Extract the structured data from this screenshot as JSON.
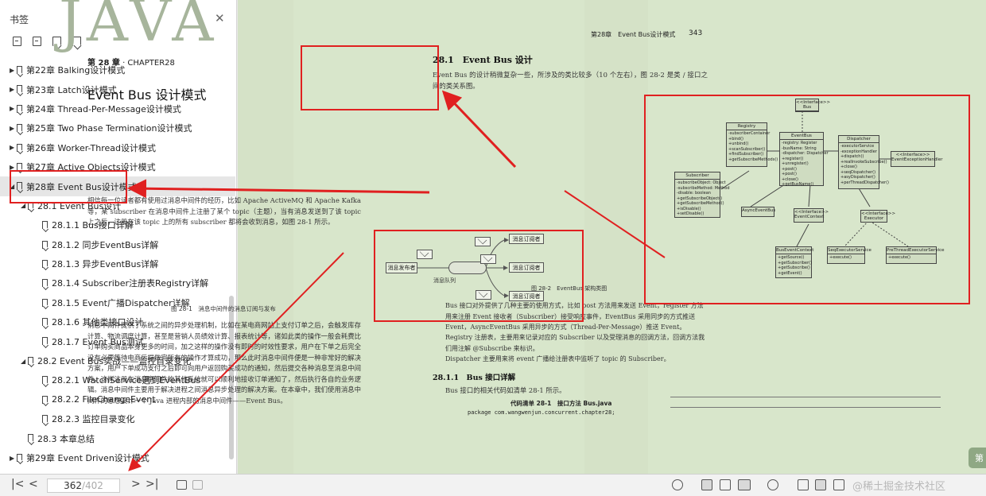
{
  "sidebar": {
    "title": "书签",
    "items": [
      {
        "label": "第22章 Balking设计模式",
        "level": 0,
        "expanded": false
      },
      {
        "label": "第23章 Latch设计模式",
        "level": 0,
        "expanded": false
      },
      {
        "label": "第24章 Thread-Per-Message设计模式",
        "level": 0,
        "expanded": false
      },
      {
        "label": "第25章 Two Phase Termination设计模式",
        "level": 0,
        "expanded": false
      },
      {
        "label": "第26章 Worker-Thread设计模式",
        "level": 0,
        "expanded": false
      },
      {
        "label": "第27章 Active Objects设计模式",
        "level": 0,
        "expanded": false
      },
      {
        "label": "第28章 Event Bus设计模式",
        "level": 0,
        "expanded": true,
        "selected": true
      },
      {
        "label": "28.1 Event Bus设计",
        "level": 1,
        "expanded": true
      },
      {
        "label": "28.1.1 Bus接口详解",
        "level": 2
      },
      {
        "label": "28.1.2 同步EventBus详解",
        "level": 2
      },
      {
        "label": "28.1.3 异步EventBus详解",
        "level": 2
      },
      {
        "label": "28.1.4 Subscriber注册表Registry详解",
        "level": 2
      },
      {
        "label": "28.1.5 Event广播Dispatcher详解",
        "level": 2
      },
      {
        "label": "28.1.6 其他类接口设计",
        "level": 2
      },
      {
        "label": "28.1.7 Event Bus测试",
        "level": 2
      },
      {
        "label": "28.2 Event Bus实战——监控目录变化",
        "level": 1,
        "expanded": true
      },
      {
        "label": "28.2.1 WatchService遇到EventBus",
        "level": 2
      },
      {
        "label": "28.2.2 FileChangeEvent",
        "level": 2
      },
      {
        "label": "28.2.3 监控目录变化",
        "level": 2
      },
      {
        "label": "28.3 本章总结",
        "level": 1
      },
      {
        "label": "第29章 Event Driven设计模式",
        "level": 0,
        "expanded": false
      }
    ]
  },
  "page_left": {
    "watermark": "JAVA",
    "chapter_label": "第 28 章",
    "chapter_label_en": " · CHAPTER28",
    "chapter_title": "Event Bus 设计模式",
    "para1": "相信每一位读者都有使用过消息中间件的经历，比如 Apache ActiveMQ 和 Apache Kafka 等，某 subscriber 在消息中间件上注册了某个 topic（主题），当有消息发送到了该 topic 上之后，注册在该 topic 上的所有 subscriber 都将会收到消息，如图 28-1 所示。",
    "fig1": {
      "publisher": "消息发布者",
      "queue": "消息队列",
      "subscriber": "消息订阅者",
      "caption": "图 28-1　消息中间件的消息订阅与发布"
    },
    "para2": "消息中间件提供了系统之间的异步处理机制，比如在某电商网站上支付订单之后，会触发库存计算、物流调度计算，甚至是营销人员绩效计算、报表统计等，诸如此类的操作一般会耗费比订单购买商品本身更多的时间，加之这样的操作没有即时的时效性要求，用户在下单之后完全没有必要等待电商后端做完所有的操作才算成功，那么此时消息中间件便是一种非常好的解决方案，用户下单成功支付之后即可向用户返回购买成功的通知，然后提交各种消息至消息中间件，这样注册在消息中间件的其他系统就可以顺利地接收订单通知了，然后执行各自的业务逻辑。消息中间件主要用于解决进程之间消息异步处理的解决方案。在本章中，我们使用消息中间件的思想设计一个 Java 进程内部的消息中间件——Event Bus。"
  },
  "page_right": {
    "running_head": "第28章　Event Bus设计模式",
    "page_number": "343",
    "section_title": "28.1　Event Bus 设计",
    "para3": "Event Bus 的设计稍微复杂一些，所涉及的类比较多（10 个左右），图 28-2 是类 / 接口之间的类关系图。",
    "uml": {
      "bus": {
        "name": "<<Interface>> Bus"
      },
      "registry": {
        "name": "Registry",
        "body": "-subscriberContainer\n+bind()\n+unbind()\n+scanSubscriber()\n+findSubscriber()\n+getSubscribeMethods()"
      },
      "eventbus": {
        "name": "EventBus",
        "body": "-registry: Register\n-busName: String\n-dispatcher: Dispatcher\n+register()\n+unregister()\n+post()\n+post()\n+close()\n+getBusName()"
      },
      "dispatcher": {
        "name": "Dispatcher",
        "body": "-executorService\n-exceptionHandler\n+dispatch()\n+realInvokeSubscribe()\n+close()\n+seqDispatcher()\n+asyDispatcher()\n+perThreadDispatcher()"
      },
      "exhandler": {
        "name": "<<Interface>> EventExceptionHandler"
      },
      "subscriber": {
        "name": "Subscriber",
        "body": "-subscribeObject: Object\n-subscribeMethod: Method\n-disable: boolean\n+getSubscribeObject()\n+getSubscribeMethod()\n+isDisable()\n+setDisable()"
      },
      "asyncbus": {
        "name": "AsyncEventBus"
      },
      "eventcontext": {
        "name": "<<Interface>> EventContext"
      },
      "executor": {
        "name": "<<Interface>> Executor"
      },
      "buseventcontext": {
        "name": "BusEventContext",
        "body": "+getSource()\n+getSubscriber()\n+getSubscribe()\n+getEvent()"
      },
      "seqexec": {
        "name": "SeqExecutorService",
        "body": "+execute()"
      },
      "perthread": {
        "name": "PreThreadExecutorService",
        "body": "+execute()"
      }
    },
    "fig2_caption": "图 28-2　EventBus 架构类图",
    "bullet1": "Bus 接口对外提供了几种主要的使用方式，比如 post 方法用来发送 Event，register 方法用来注册 Event 接收者（Subscriber）接受响应事件，EventBus 采用同步的方式推送 Event，AsyncEventBus 采用异步的方式（Thread-Per-Message）推送 Event。",
    "bullet2": "Registry 注册表，主要用来记录对应的 Subscriber 以及受理消息的回调方法，回调方法我们用注解 @Subscribe 来标识。",
    "bullet3": "Dispatcher 主要用来将 event 广播给注册表中监听了 topic 的 Subscriber。",
    "subsection_title": "28.1.1　Bus 接口详解",
    "para4": "Bus 接口的相关代码如清单 28-1 所示。",
    "code_caption": "代码清单 28-1　接口方法 Bus.java",
    "code_line": "package com.wangwenjun.concurrent.chapter28;"
  },
  "corner_button": "第",
  "bottombar": {
    "page_current": "362",
    "page_total": "/402",
    "watermark": "@稀土掘金技术社区"
  },
  "colors": {
    "annotation": "#e02020",
    "page_bg": "#d8e6cb"
  }
}
